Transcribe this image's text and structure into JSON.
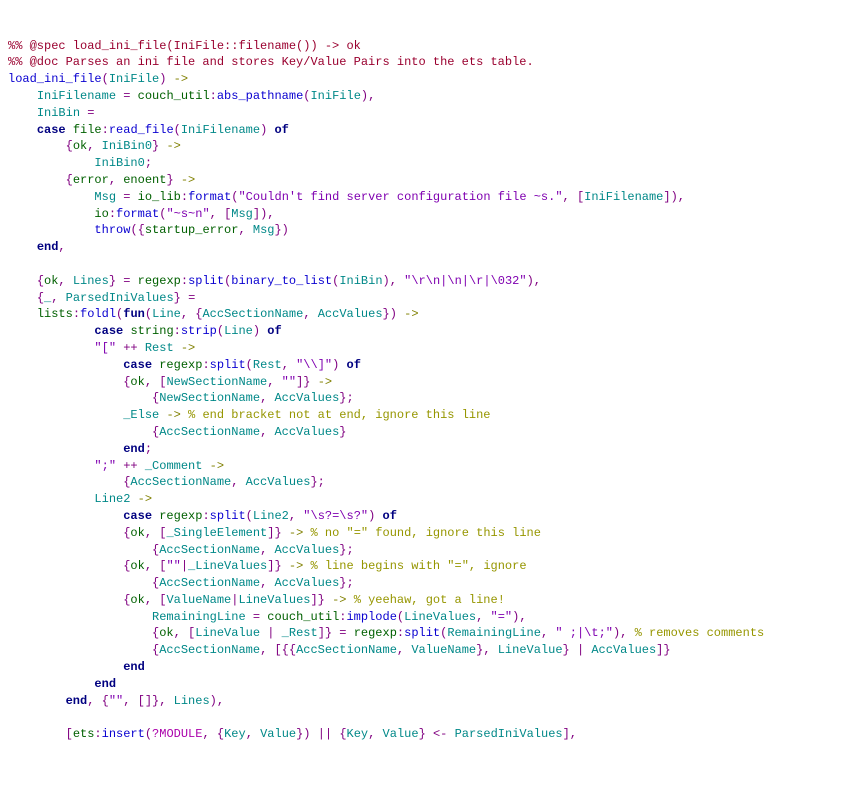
{
  "lines": {
    "l1": "%% @spec load_ini_file(IniFile::filename()) -> ok",
    "l2": "%% @doc Parses an ini file and stores Key/Value Pairs into the ets table.",
    "l3a": "load_ini_file",
    "l3b": "IniFile",
    "l4a": "IniFilename",
    "l4b": "couch_util",
    "l4c": "abs_pathname",
    "l4d": "IniFile",
    "l5a": "IniBin",
    "l6a": "file",
    "l6b": "read_file",
    "l6c": "IniFilename",
    "l7a": "ok",
    "l7b": "IniBin0",
    "l8a": "IniBin0",
    "l9a": "error",
    "l9b": "enoent",
    "l10a": "Msg",
    "l10b": "io_lib",
    "l10c": "format",
    "l10d": "\"Couldn't find server configuration file ~s.\"",
    "l10e": "IniFilename",
    "l11a": "io",
    "l11b": "format",
    "l11c": "\"~s~n\"",
    "l11d": "Msg",
    "l12a": "throw",
    "l12b": "startup_error",
    "l12c": "Msg",
    "l14a": "ok",
    "l14b": "Lines",
    "l14c": "regexp",
    "l14d": "split",
    "l14e": "binary_to_list",
    "l14f": "IniBin",
    "l14g": "\"\\r\\n|\\n|\\r|\\032\"",
    "l15a": "_",
    "l15b": "ParsedIniValues",
    "l16a": "lists",
    "l16b": "foldl",
    "l16c": "Line",
    "l16d": "AccSectionName",
    "l16e": "AccValues",
    "l17a": "string",
    "l17b": "strip",
    "l17c": "Line",
    "l18a": "\"[\"",
    "l18b": "Rest",
    "l19a": "regexp",
    "l19b": "split",
    "l19c": "Rest",
    "l19d": "\"\\\\]\"",
    "l20a": "ok",
    "l20b": "NewSectionName",
    "l20c": "\"\"",
    "l21a": "NewSectionName",
    "l21b": "AccValues",
    "l22a": "_Else",
    "l22b": "% end bracket not at end, ignore this line",
    "l23a": "AccSectionName",
    "l23b": "AccValues",
    "l25a": "\";\"",
    "l25b": "_Comment",
    "l26a": "AccSectionName",
    "l26b": "AccValues",
    "l27a": "Line2",
    "l28a": "regexp",
    "l28b": "split",
    "l28c": "Line2",
    "l28d": "\"\\s?=\\s?\"",
    "l29a": "ok",
    "l29b": "_SingleElement",
    "l29c": "% no \"=\" found, ignore this line",
    "l30a": "AccSectionName",
    "l30b": "AccValues",
    "l31a": "ok",
    "l31b": "\"\"",
    "l31c": "_LineValues",
    "l31d": "% line begins with \"=\", ignore",
    "l32a": "AccSectionName",
    "l32b": "AccValues",
    "l33a": "ok",
    "l33b": "ValueName",
    "l33c": "LineValues",
    "l33d": "% yeehaw, got a line!",
    "l34a": "RemainingLine",
    "l34b": "couch_util",
    "l34c": "implode",
    "l34d": "LineValues",
    "l34e": "\"=\"",
    "l35a": "ok",
    "l35b": "LineValue",
    "l35c": "_Rest",
    "l35d": "regexp",
    "l35e": "split",
    "l35f": "RemainingLine",
    "l35g": "\" ;|\\t;\"",
    "l35h": "% removes comments",
    "l36a": "AccSectionName",
    "l36b": "AccSectionName",
    "l36c": "ValueName",
    "l36d": "LineValue",
    "l36e": "AccValues",
    "l39a": "\"\"",
    "l39b": "Lines",
    "l41a": "ets",
    "l41b": "insert",
    "l41c": "?",
    "l41d": "MODULE",
    "l41e": "Key",
    "l41f": "Value",
    "l41g": "Key",
    "l41h": "Value",
    "l41i": "ParsedIniValues",
    "case": "case",
    "of": "of",
    "end": "end",
    "fun": "fun",
    "arrow": "->",
    "pluplus": "++"
  }
}
